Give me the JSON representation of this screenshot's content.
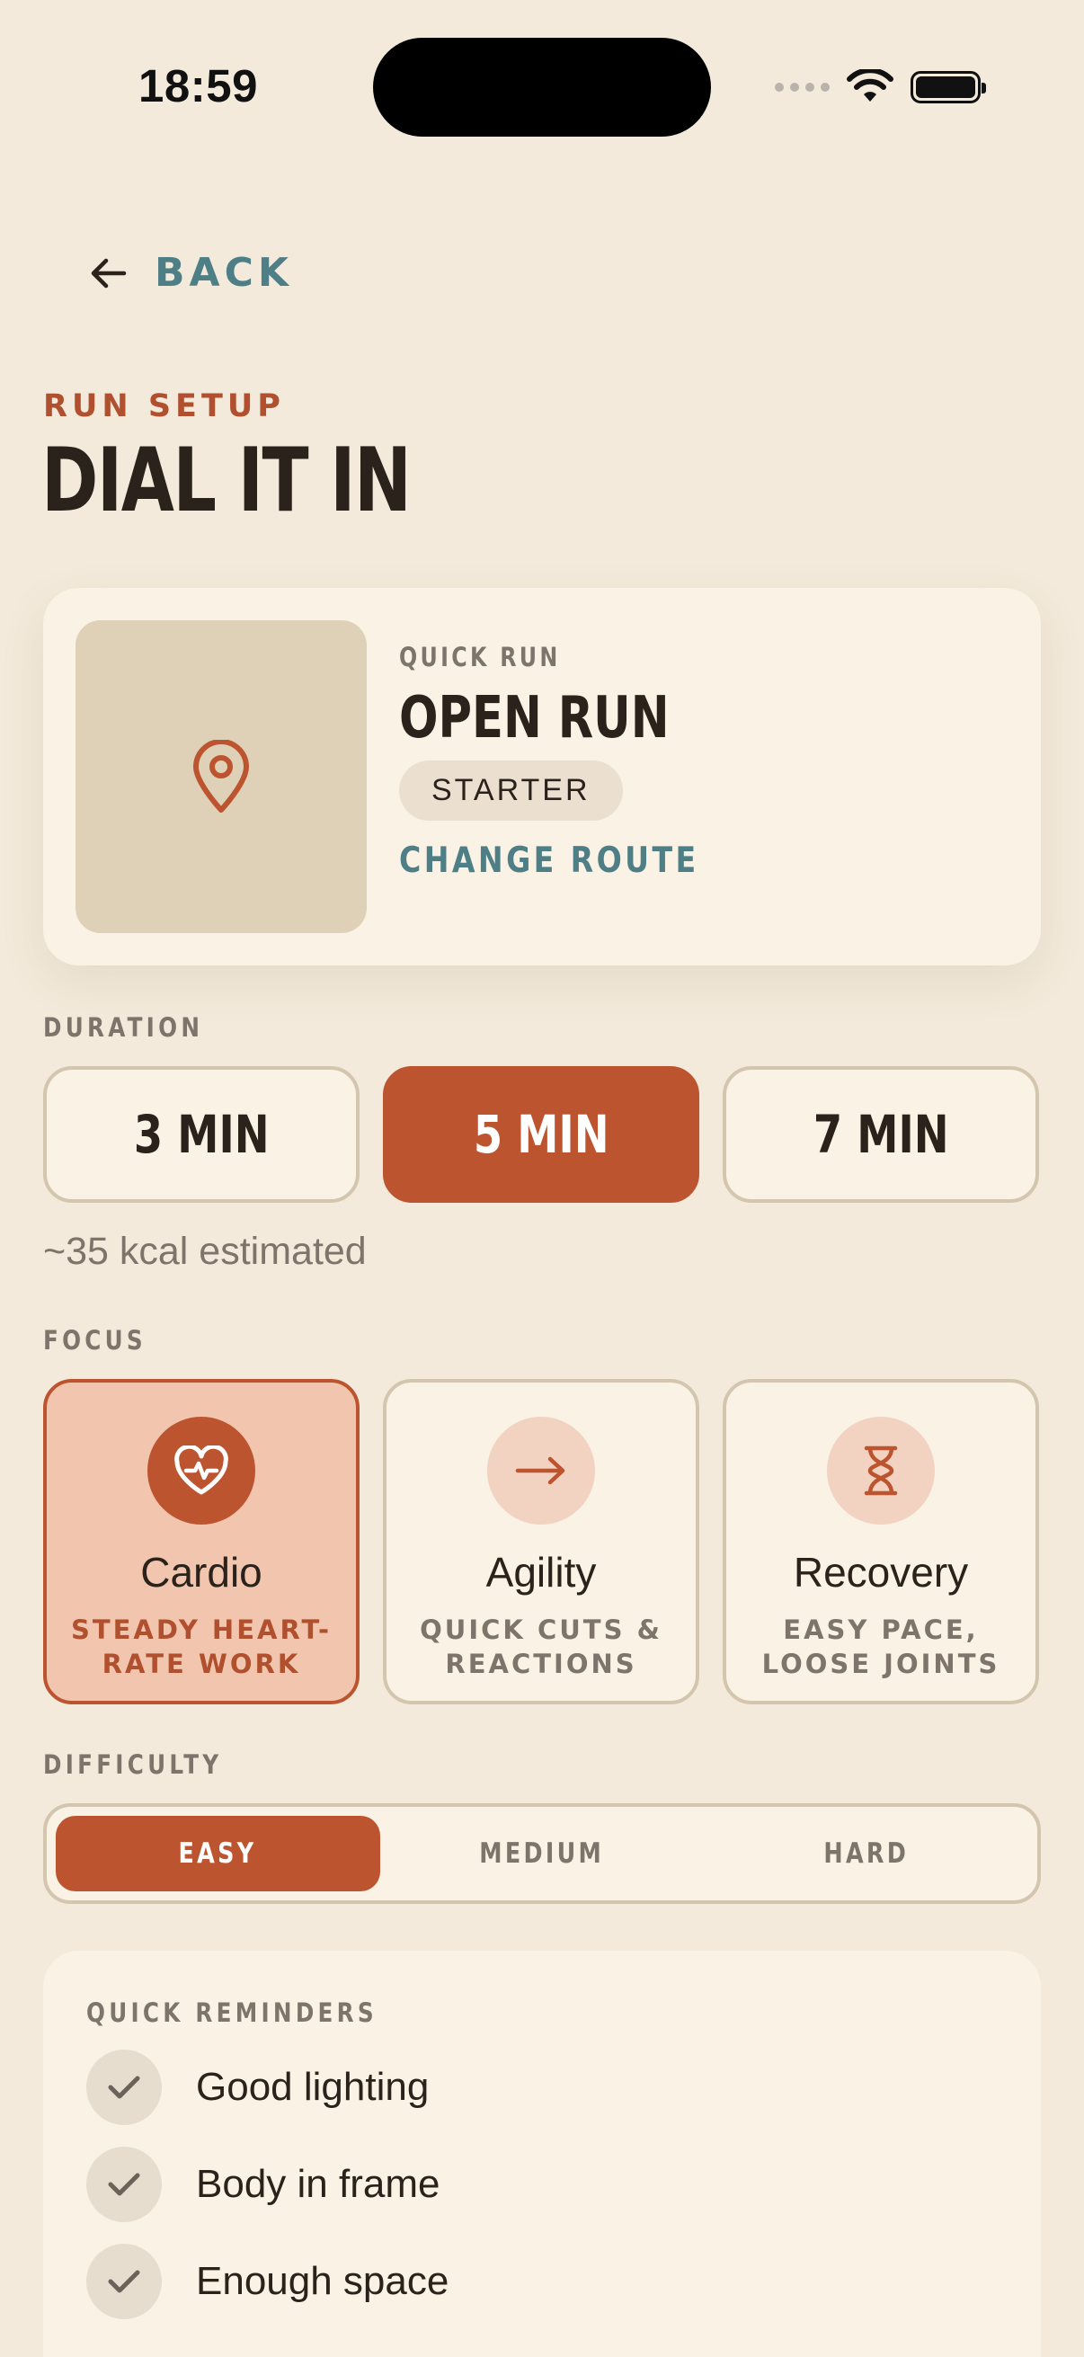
{
  "status_bar": {
    "time": "18:59"
  },
  "nav": {
    "back_label": "BACK"
  },
  "header": {
    "eyebrow": "RUN SETUP",
    "title": "DIAL IT IN"
  },
  "route": {
    "kicker": "QUICK RUN",
    "name": "OPEN RUN",
    "badge": "STARTER",
    "change_label": "CHANGE ROUTE",
    "thumb_icon": "map-pin-icon"
  },
  "duration": {
    "label": "DURATION",
    "options": [
      "3 MIN",
      "5 MIN",
      "7 MIN"
    ],
    "selected": "5 MIN",
    "estimate": "~35 kcal estimated"
  },
  "focus": {
    "label": "FOCUS",
    "options": [
      {
        "name": "Cardio",
        "desc": "STEADY HEART-RATE WORK",
        "icon": "heart-pulse-icon",
        "selected": true
      },
      {
        "name": "Agility",
        "desc": "QUICK CUTS & REACTIONS",
        "icon": "arrow-right-icon",
        "selected": false
      },
      {
        "name": "Recovery",
        "desc": "EASY PACE, LOOSE JOINTS",
        "icon": "hourglass-icon",
        "selected": false
      }
    ]
  },
  "difficulty": {
    "label": "DIFFICULTY",
    "options": [
      "EASY",
      "MEDIUM",
      "HARD"
    ],
    "selected": "EASY"
  },
  "reminders": {
    "title": "QUICK REMINDERS",
    "items": [
      "Good lighting",
      "Body in frame",
      "Enough space"
    ]
  },
  "colors": {
    "accent": "#bd5430",
    "link": "#4e7f86",
    "background": "#f3eadb",
    "card": "#faf2e4",
    "selected_tint": "#f2c6ae"
  }
}
